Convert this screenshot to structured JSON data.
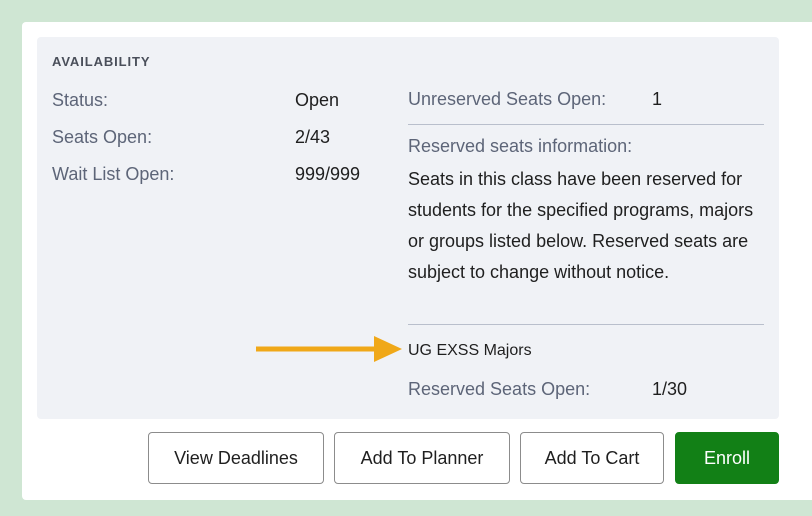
{
  "availability": {
    "heading": "AVAILABILITY",
    "status_label": "Status:",
    "status_value": "Open",
    "seats_open_label": "Seats Open:",
    "seats_open_value": "2/43",
    "waitlist_label": "Wait List Open:",
    "waitlist_value": "999/999"
  },
  "reserved": {
    "unreserved_label": "Unreserved Seats Open:",
    "unreserved_value": "1",
    "info_label": "Reserved seats information:",
    "description": "Seats in this class have been reserved for students for the specified programs, majors or groups listed below. Reserved seats are subject to change without notice.",
    "group_name": "UG EXSS Majors",
    "group_open_label": "Reserved Seats Open:",
    "group_open_value": "1/30"
  },
  "annotation": {
    "arrow_color": "#f0a818"
  },
  "actions": {
    "view_deadlines": "View Deadlines",
    "add_to_planner": "Add To Planner",
    "add_to_cart": "Add To Cart",
    "enroll": "Enroll",
    "enroll_color": "#128016"
  }
}
